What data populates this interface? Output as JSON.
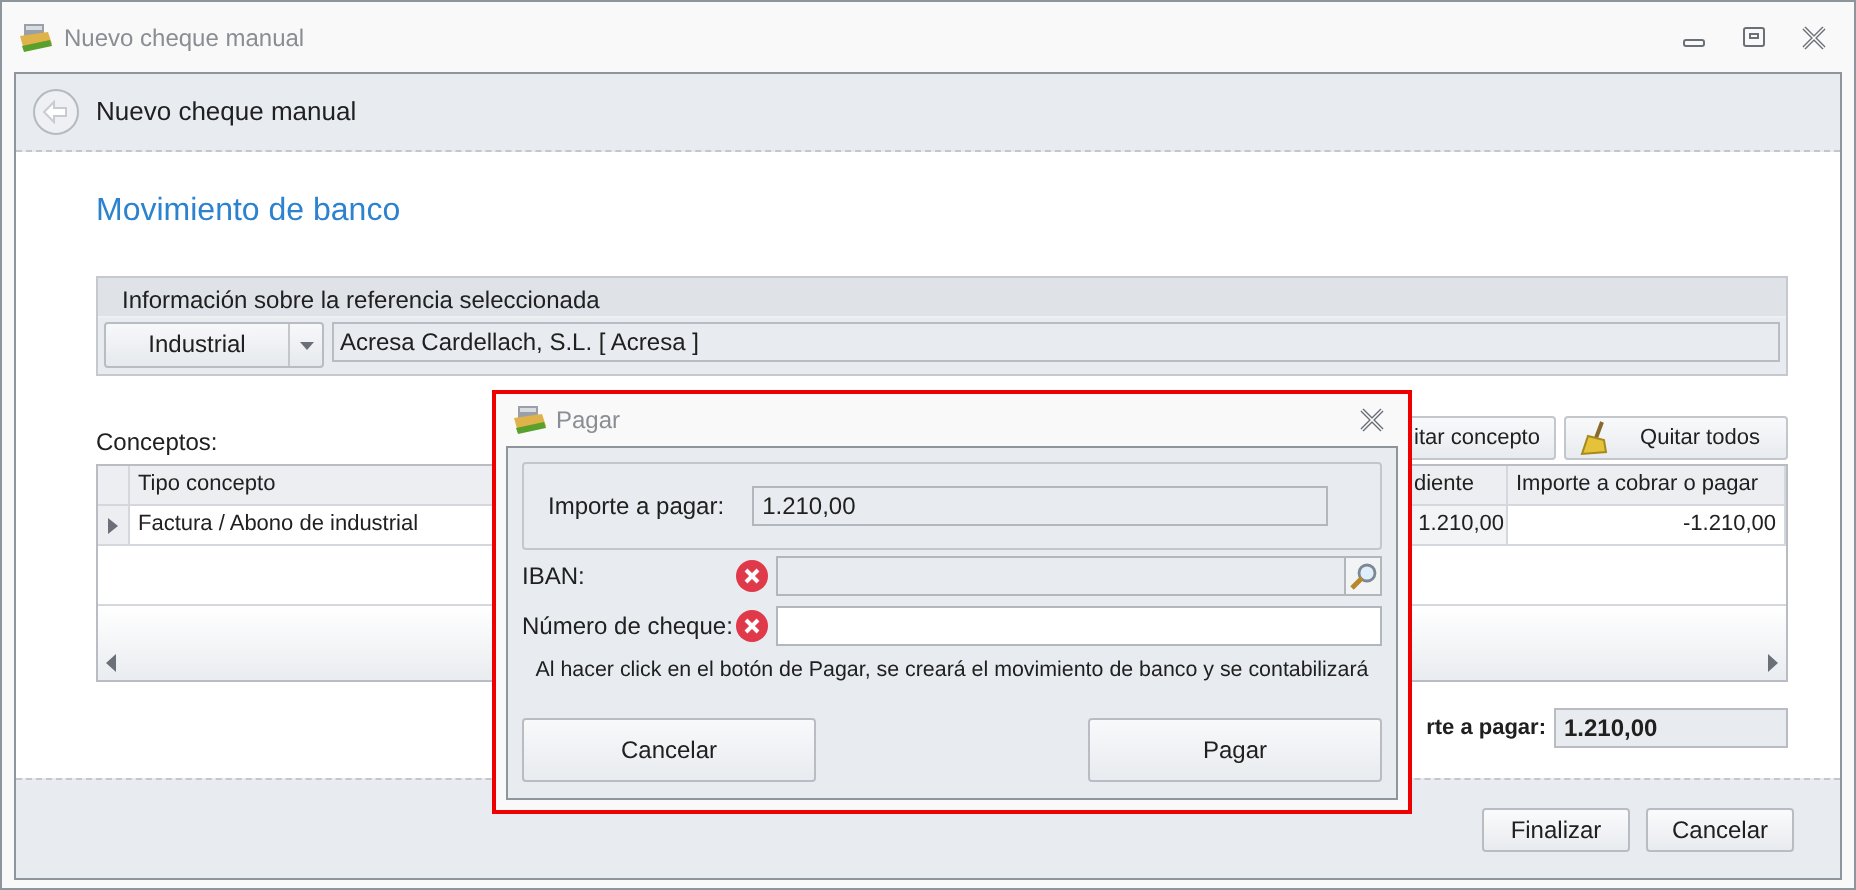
{
  "window": {
    "title": "Nuevo cheque manual"
  },
  "header": {
    "title": "Nuevo cheque manual"
  },
  "section_title": "Movimiento de banco",
  "reference": {
    "caption": "Información sobre la referencia seleccionada",
    "type": "Industrial",
    "name": "Acresa Cardellach, S.L. [ Acresa ]"
  },
  "concepts": {
    "label": "Conceptos:",
    "buttons": [
      {
        "label": "itar concepto",
        "kind": "plain"
      },
      {
        "label": "Quitar todos",
        "kind": "broom"
      }
    ],
    "columns": [
      "Tipo concepto",
      "diente",
      "Importe a cobrar o pagar"
    ],
    "rows": [
      {
        "current": true,
        "cells": [
          "Factura / Abono de industrial",
          "1.210,00",
          "-1.210,00"
        ]
      }
    ]
  },
  "total": {
    "label": "rte a pagar:",
    "value": "1.210,00"
  },
  "footer_buttons": [
    "Finalizar",
    "Cancelar"
  ],
  "dialog": {
    "title": "Pagar",
    "highlighted": true,
    "amount": {
      "label": "Importe a pagar:",
      "value": "1.210,00"
    },
    "fields": [
      {
        "label": "IBAN:",
        "error": true,
        "kind": "lookup"
      },
      {
        "label": "Número de cheque:",
        "error": true,
        "kind": "text"
      }
    ],
    "message": "Al hacer click en el botón de Pagar, se creará el movimiento de banco y se contabilizará",
    "buttons": [
      "Cancelar",
      "Pagar"
    ]
  }
}
